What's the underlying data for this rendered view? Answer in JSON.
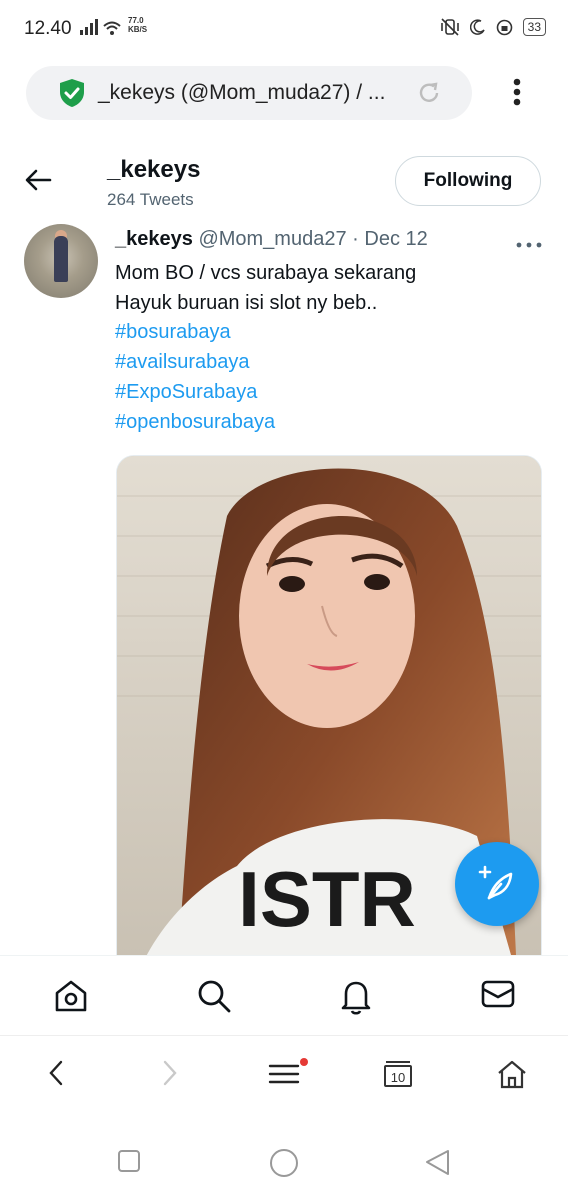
{
  "status_bar": {
    "time": "12.40",
    "speed_value": "77.0",
    "speed_unit": "KB/S",
    "battery": "33"
  },
  "browser": {
    "url_text": "_kekeys (@Mom_muda27) / ...",
    "icons": [
      "shield-check-icon",
      "reload-icon",
      "more-vertical-icon"
    ]
  },
  "profile_header": {
    "name": "_kekeys",
    "tweet_count": "264 Tweets",
    "follow_button": "Following"
  },
  "tweet": {
    "display_name": "_kekeys",
    "handle": "@Mom_muda27",
    "separator": "·",
    "date": "Dec 12",
    "lines": [
      "Mom BO / vcs surabaya sekarang",
      "Hayuk buruan isi slot ny beb.."
    ],
    "hashtags": [
      "#bosurabaya",
      "#availsurabaya",
      "#ExpoSurabaya",
      "#openbosurabaya"
    ],
    "photo_text": "ISTR"
  },
  "bottom_tabs": [
    "home-icon",
    "search-icon",
    "notifications-icon",
    "messages-icon"
  ],
  "browser_toolbar": {
    "tab_count": "10",
    "icons": [
      "back-icon",
      "forward-icon",
      "menu-icon",
      "tabs-icon",
      "home-icon"
    ]
  },
  "colors": {
    "accent": "#1d9bf0",
    "text": "#0f1419",
    "secondary_text": "#536471",
    "shield_green": "#1e9e4a",
    "notification_dot": "#e53935"
  }
}
